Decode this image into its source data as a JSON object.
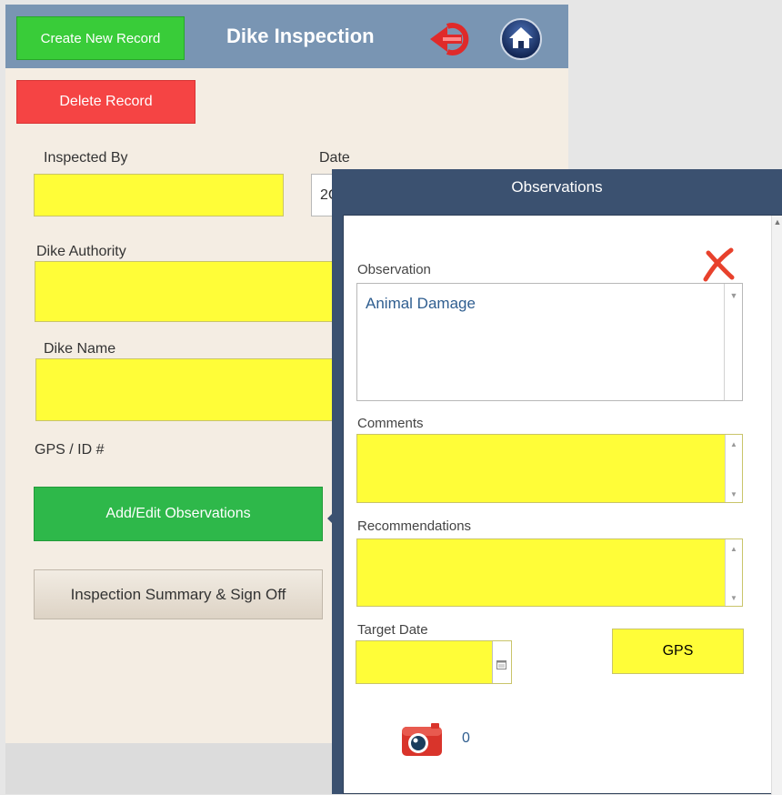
{
  "header": {
    "create_label": "Create New Record",
    "title": "Dike Inspection",
    "back_icon": "back-arrow-icon",
    "home_icon": "home-icon",
    "bg_color": "#7995b3"
  },
  "toolbar": {
    "delete_label": "Delete Record"
  },
  "form": {
    "inspected_by_label": "Inspected By",
    "inspected_by_value": "",
    "date_label": "Date",
    "date_value": "2C",
    "dike_authority_label": "Dike Authority",
    "dike_authority_value": "",
    "dike_name_label": "Dike Name",
    "dike_name_value": "",
    "gps_label": "GPS / ID #"
  },
  "actions": {
    "add_edit_label": "Add/Edit Observations",
    "summary_label": "Inspection  Summary & Sign Off"
  },
  "modal": {
    "title": "Observations",
    "observation_label": "Observation",
    "observation_value": "Animal Damage",
    "comments_label": "Comments",
    "comments_value": "",
    "recommendations_label": "Recommendations",
    "recommendations_value": "",
    "target_date_label": "Target Date",
    "target_date_value": "",
    "gps_button_label": "GPS",
    "photo_count": "0",
    "close_icon": "close-icon",
    "camera_icon": "camera-icon"
  },
  "colors": {
    "required_field": "#fffd38",
    "create_button": "#39cc39",
    "delete_button": "#f54444",
    "add_edit_button": "#2eb84a",
    "modal_frame": "#3b5170"
  }
}
